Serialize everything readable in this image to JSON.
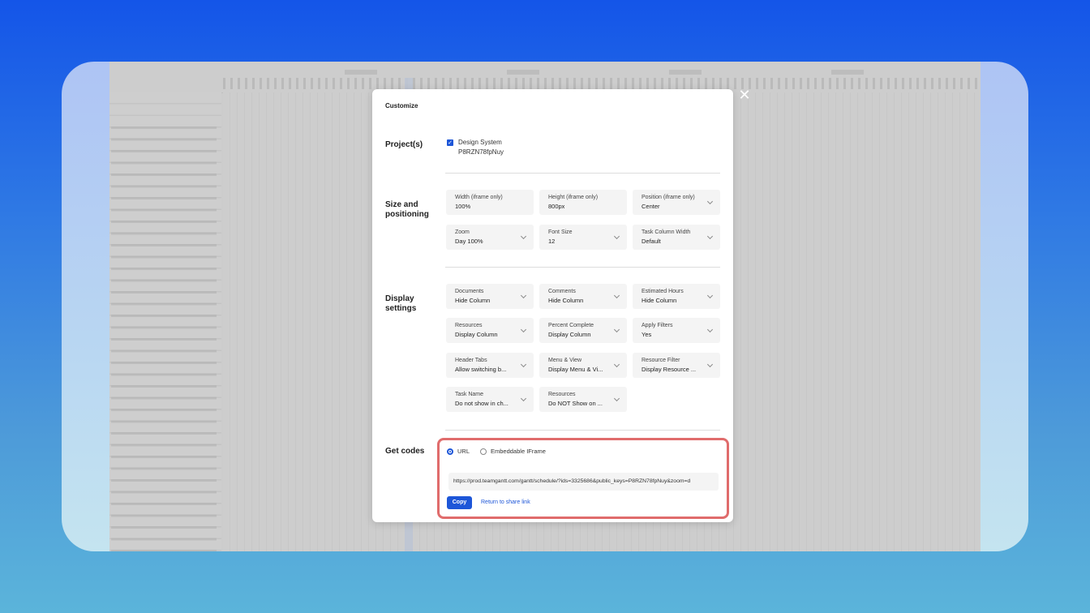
{
  "modal": {
    "title": "Customize",
    "close_icon": "close-icon"
  },
  "projects": {
    "label": "Project(s)",
    "item_name": "Design System",
    "item_key": "P8RZN78fpNuy",
    "checked": true
  },
  "size": {
    "label": "Size and positioning",
    "fields": [
      {
        "label": "Width (iframe only)",
        "value": "100%"
      },
      {
        "label": "Height (iframe only)",
        "value": "800px"
      },
      {
        "label": "Position (iframe only)",
        "value": "Center"
      },
      {
        "label": "Zoom",
        "value": "Day 100%"
      },
      {
        "label": "Font Size",
        "value": "12"
      },
      {
        "label": "Task Column Width",
        "value": "Default"
      }
    ]
  },
  "display": {
    "label": "Display settings",
    "fields": [
      {
        "label": "Documents",
        "value": "Hide Column"
      },
      {
        "label": "Comments",
        "value": "Hide Column"
      },
      {
        "label": "Estimated Hours",
        "value": "Hide Column"
      },
      {
        "label": "Resources",
        "value": "Display Column"
      },
      {
        "label": "Percent Complete",
        "value": "Display Column"
      },
      {
        "label": "Apply Filters",
        "value": "Yes"
      },
      {
        "label": "Header Tabs",
        "value": "Allow switching b..."
      },
      {
        "label": "Menu & View",
        "value": "Display Menu & Vi..."
      },
      {
        "label": "Resource Filter",
        "value": "Display Resource ..."
      },
      {
        "label": "Task Name",
        "value": "Do not show in ch..."
      },
      {
        "label": "Resources",
        "value": "Do NOT Show on ..."
      }
    ]
  },
  "codes": {
    "label": "Get codes",
    "option_url": "URL",
    "option_iframe": "Embeddable IFrame",
    "selected": "URL",
    "url_value": "https://prod.teamgantt.com/gantt/schedule/?ids=3325686&public_keys=P8RZN78fpNuy&zoom=d",
    "copy_label": "Copy",
    "return_label": "Return to share link"
  },
  "colors": {
    "accent": "#1d56d8",
    "highlight": "#e06c6c"
  }
}
